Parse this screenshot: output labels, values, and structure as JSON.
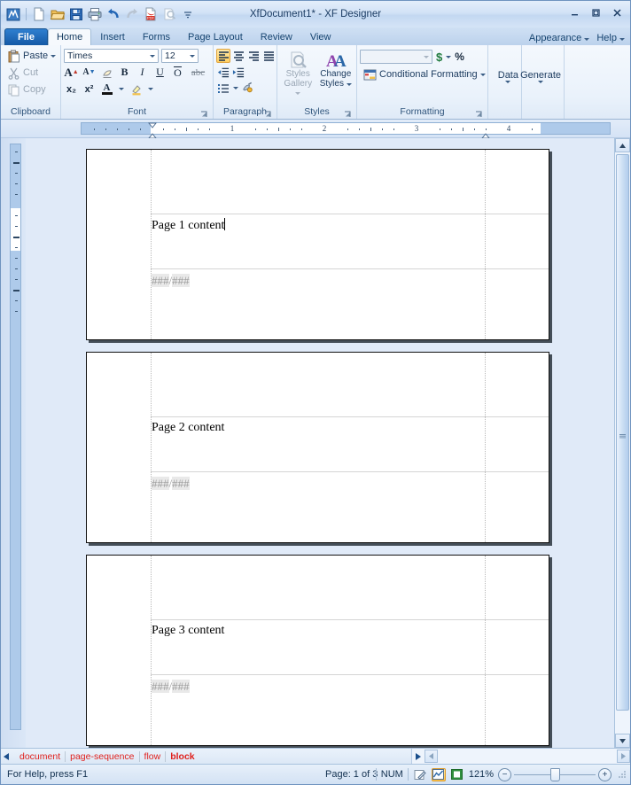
{
  "window": {
    "title": "XfDocument1* - XF Designer",
    "minimize": "–",
    "restore": "❐",
    "close": "✕"
  },
  "quick_access": [
    {
      "name": "app-logo-icon",
      "label": "XF"
    },
    {
      "name": "new-document-icon",
      "label": "New"
    },
    {
      "name": "open-folder-icon",
      "label": "Open"
    },
    {
      "name": "save-icon",
      "label": "Save"
    },
    {
      "name": "print-icon",
      "label": "Print"
    },
    {
      "name": "undo-icon",
      "label": "Undo"
    },
    {
      "name": "redo-icon",
      "label": "Redo"
    },
    {
      "name": "export-pdf-icon",
      "label": "Export PDF"
    },
    {
      "name": "print-preview-icon",
      "label": "Print Preview"
    },
    {
      "name": "customize-toolbar-icon",
      "label": "Customize Quick Access Toolbar"
    }
  ],
  "tabs": [
    {
      "label": "File",
      "active": false,
      "kind": "file"
    },
    {
      "label": "Home",
      "active": true,
      "kind": "normal"
    },
    {
      "label": "Insert",
      "active": false,
      "kind": "normal"
    },
    {
      "label": "Forms",
      "active": false,
      "kind": "normal"
    },
    {
      "label": "Page Layout",
      "active": false,
      "kind": "normal"
    },
    {
      "label": "Review",
      "active": false,
      "kind": "normal"
    },
    {
      "label": "View",
      "active": false,
      "kind": "normal"
    }
  ],
  "tabs_right": [
    {
      "label": "Appearance"
    },
    {
      "label": "Help"
    }
  ],
  "ribbon": {
    "clipboard": {
      "label": "Clipboard",
      "paste": "Paste",
      "cut": "Cut",
      "copy": "Copy"
    },
    "font": {
      "label": "Font",
      "font_name": "Times",
      "font_size": "12",
      "grow": "A",
      "shrink": "A",
      "clear_formatting": "Clear Formatting",
      "bold": "B",
      "italic": "I",
      "underline": "U",
      "overline": "O",
      "strikethrough": "abc",
      "subscript": "x₂",
      "superscript": "x²",
      "font_color": "A",
      "highlight": "Highlight"
    },
    "paragraph": {
      "label": "Paragraph",
      "align_left": "Align Left",
      "align_center": "Center",
      "align_right": "Align Right",
      "justify": "Justify",
      "decrease_indent": "Decrease Indent",
      "increase_indent": "Increase Indent",
      "bullets": "Bullets",
      "borders": "Borders"
    },
    "styles": {
      "label": "Styles",
      "styles_gallery": "Styles Gallery",
      "change_styles": "Change Styles"
    },
    "formatting": {
      "label": "Formatting",
      "number_format": "",
      "currency": "$",
      "percent": "%",
      "conditional_formatting": "Conditional Formatting"
    },
    "data_button": "Data",
    "generate_button": "Generate"
  },
  "ruler": {
    "horizontal_numbers": [
      "1",
      "2",
      "3",
      "4"
    ],
    "left_indent_marker": "left-indent-marker",
    "right_indent_marker": "right-indent-marker"
  },
  "document": {
    "pages": [
      {
        "text": "Page 1 content",
        "has_caret": true,
        "field_left": "###",
        "field_sep": "/",
        "field_right": "###"
      },
      {
        "text": "Page 2 content",
        "has_caret": false,
        "field_left": "###",
        "field_sep": "/",
        "field_right": "###"
      },
      {
        "text": "Page 3 content",
        "has_caret": false,
        "field_left": "###",
        "field_sep": "/",
        "field_right": "###"
      }
    ]
  },
  "breadcrumb": {
    "items": [
      {
        "label": "document",
        "current": false
      },
      {
        "label": "page-sequence",
        "current": false
      },
      {
        "label": "flow",
        "current": false
      },
      {
        "label": "block",
        "current": true
      }
    ]
  },
  "status": {
    "help_text": "For Help, press F1",
    "page_indicator": "Page: 1 of 3",
    "num_lock": "NUM",
    "zoom_level": "121%",
    "zoom_out": "−",
    "zoom_in": "+",
    "view_edit": "edit-view-icon",
    "view_chart": "chart-view-icon",
    "view_preview": "preview-view-icon"
  },
  "colors": {
    "accent_blue": "#1559a5",
    "breadcrumb_red": "#e0201c",
    "selected_gold": "#ffc64a",
    "workspace_bg": "#e0eaf8",
    "field_shading": "#e9e9e9"
  }
}
